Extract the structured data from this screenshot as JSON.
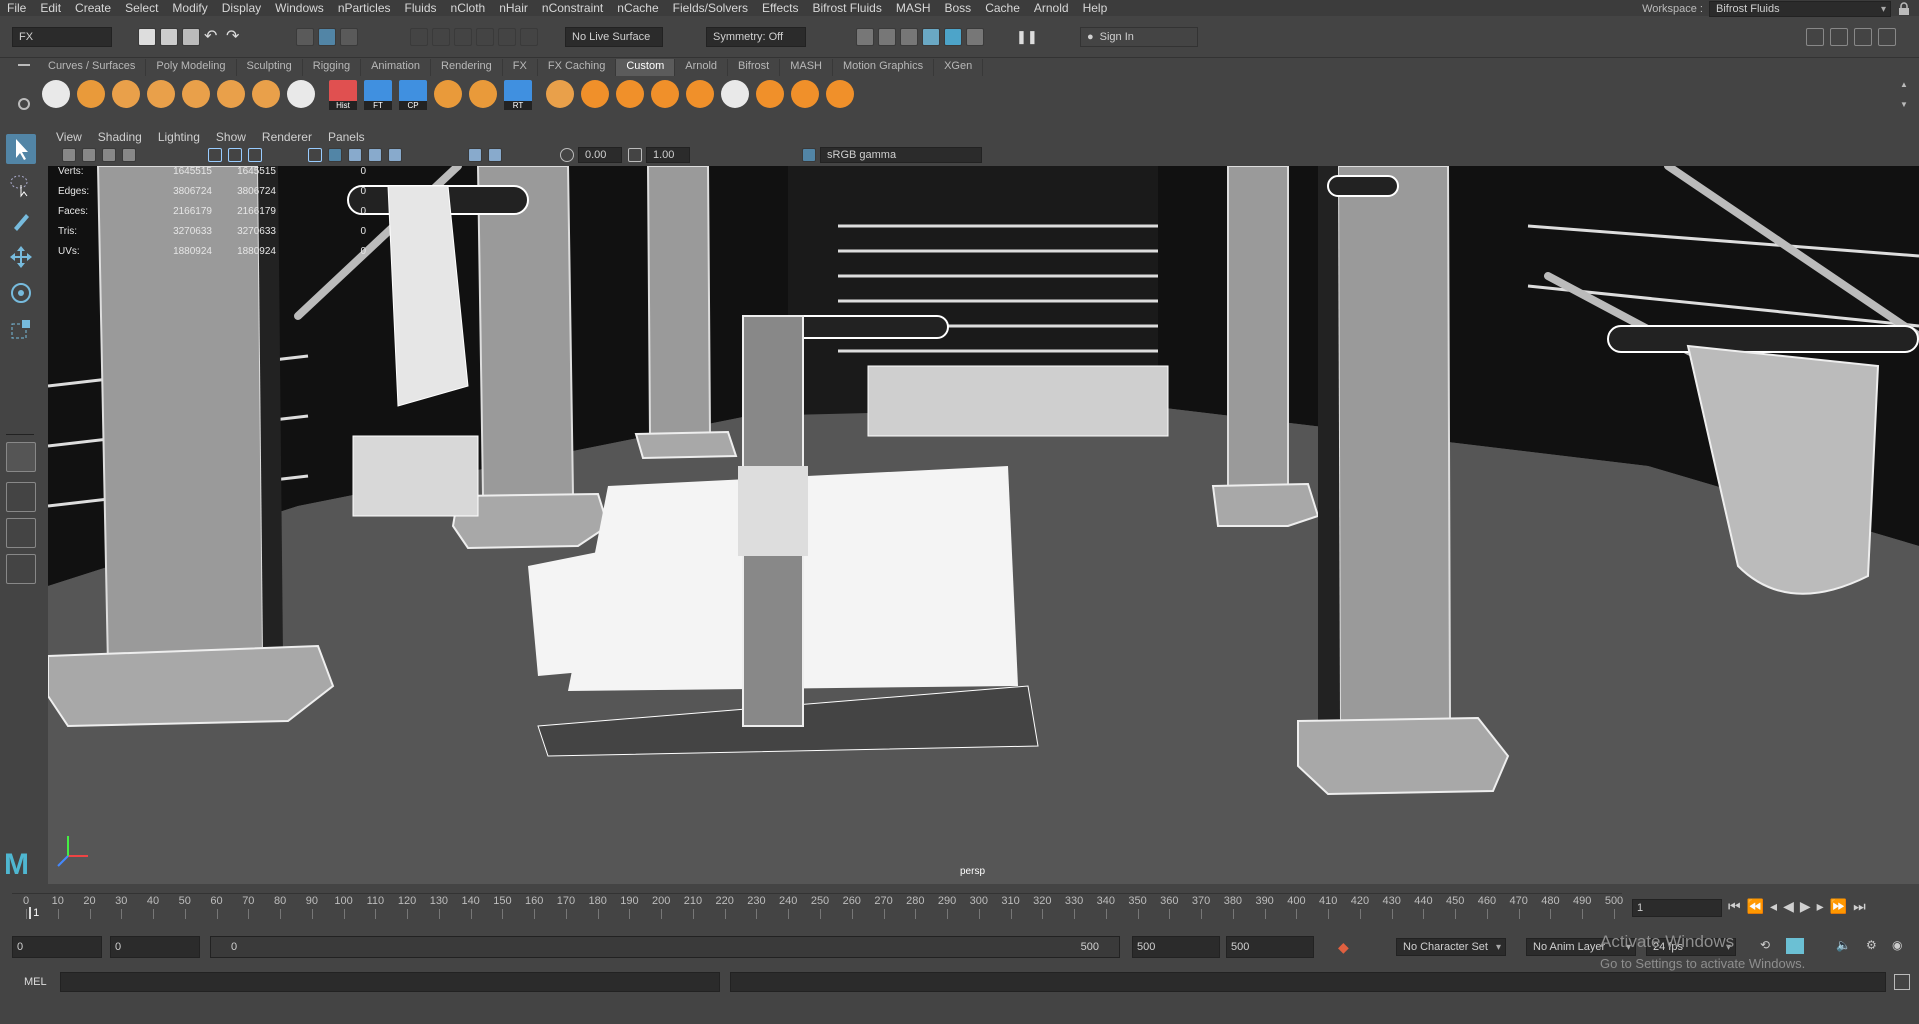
{
  "menus": [
    "File",
    "Edit",
    "Create",
    "Select",
    "Modify",
    "Display",
    "Windows",
    "nParticles",
    "Fluids",
    "nCloth",
    "nHair",
    "nConstraint",
    "nCache",
    "Fields/Solvers",
    "Effects",
    "Bifrost Fluids",
    "MASH",
    "Boss",
    "Cache",
    "Arnold",
    "Help"
  ],
  "workspace": {
    "label": "Workspace :",
    "value": "Bifrost Fluids"
  },
  "statusline": {
    "menuset": "FX",
    "live_surface": "No Live Surface",
    "symmetry": "Symmetry: Off",
    "sign_in": "Sign In"
  },
  "shelf_tabs": [
    "Curves / Surfaces",
    "Poly Modeling",
    "Sculpting",
    "Rigging",
    "Animation",
    "Rendering",
    "FX",
    "FX Caching",
    "Custom",
    "Arnold",
    "Bifrost",
    "MASH",
    "Motion Graphics",
    "XGen"
  ],
  "active_shelf_tab": "Custom",
  "shelf_labels": {
    "hist": "Hist",
    "ft": "FT",
    "cp": "CP",
    "rt": "RT"
  },
  "panel_menus": [
    "View",
    "Shading",
    "Lighting",
    "Show",
    "Renderer",
    "Panels"
  ],
  "viewport_toolbar": {
    "field1": "0.00",
    "field2": "1.00",
    "colorspace": "sRGB gamma"
  },
  "hud": {
    "rows": [
      {
        "label": "Verts:",
        "v1": "1645515",
        "v2": "1645515",
        "v3": "0"
      },
      {
        "label": "Edges:",
        "v1": "3806724",
        "v2": "3806724",
        "v3": "0"
      },
      {
        "label": "Faces:",
        "v1": "2166179",
        "v2": "2166179",
        "v3": "0"
      },
      {
        "label": "Tris:",
        "v1": "3270633",
        "v2": "3270633",
        "v3": "0"
      },
      {
        "label": "UVs:",
        "v1": "1880924",
        "v2": "1880924",
        "v3": "0"
      }
    ]
  },
  "camera_label": "persp",
  "timeline": {
    "ticks": [
      "0",
      "10",
      "20",
      "30",
      "40",
      "50",
      "60",
      "70",
      "80",
      "90",
      "100",
      "110",
      "120",
      "130",
      "140",
      "150",
      "160",
      "170",
      "180",
      "190",
      "200",
      "210",
      "220",
      "230",
      "240",
      "250",
      "260",
      "270",
      "280",
      "290",
      "300",
      "310",
      "320",
      "330",
      "340",
      "350",
      "360",
      "370",
      "380",
      "390",
      "400",
      "410",
      "420",
      "430",
      "440",
      "450",
      "460",
      "470",
      "480",
      "490",
      "500"
    ],
    "current_marker": "1",
    "current_frame": "1"
  },
  "range": {
    "start": "0",
    "playback_start": "0",
    "slider_start": "0",
    "slider_end": "500",
    "playback_end": "500",
    "end": "500",
    "character_set": "No Character Set",
    "anim_layer": "No Anim Layer",
    "fps": "24 fps"
  },
  "command_line": {
    "label": "MEL"
  },
  "watermark": {
    "line1": "Activate Windows",
    "line2": "Go to Settings to activate Windows."
  }
}
